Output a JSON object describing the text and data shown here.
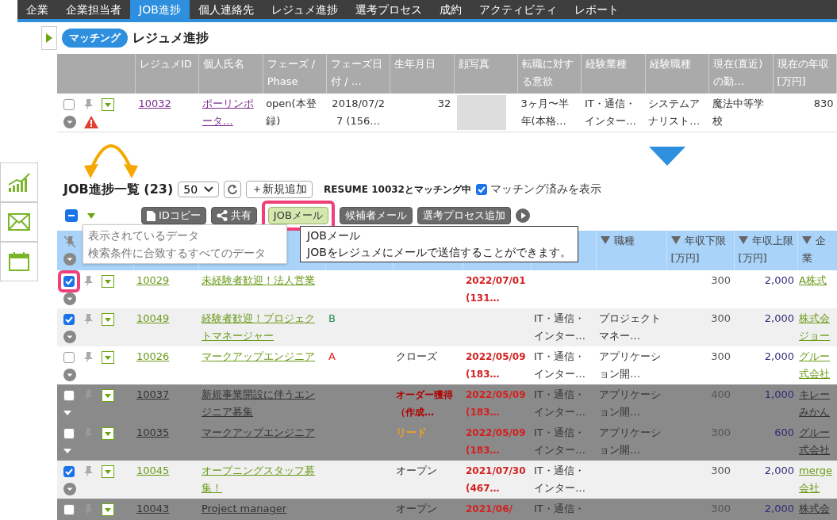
{
  "nav": {
    "tabs": [
      {
        "label": "企業",
        "selected": false
      },
      {
        "label": "企業担当者",
        "selected": false
      },
      {
        "label": "JOB進捗",
        "selected": true
      },
      {
        "label": "個人連絡先",
        "selected": false
      },
      {
        "label": "レジュメ進捗",
        "selected": false
      },
      {
        "label": "選考プロセス",
        "selected": false
      },
      {
        "label": "成約",
        "selected": false
      },
      {
        "label": "アクティビティ",
        "selected": false
      },
      {
        "label": "レポート",
        "selected": false
      }
    ]
  },
  "matching": {
    "badge": "マッチング",
    "title": "レジュメ進捗",
    "columns": [
      "レジュメID",
      "個人氏名",
      "フェーズ / Phase",
      "フェーズ日付 / …",
      "生年月日",
      "顔写真",
      "転職に対する意欲",
      "経験業種",
      "経験職種",
      "現在(直近)の勤…",
      "現在の年収 [万円]"
    ],
    "rows": [
      {
        "checked": false,
        "warning": true,
        "id": "10032",
        "name": "ポーリンポータ…",
        "phase": "open(本登録)",
        "phase_date": "2018/07/27 (156…",
        "age": "32",
        "motivation": "3ヶ月〜半年(本格…",
        "industry": "IT・通信・インター…",
        "job": "システムアナリスト…",
        "school": "魔法中等学校",
        "salary": "830"
      }
    ]
  },
  "job_list": {
    "title": "JOB進捗一覧 (23)",
    "page_size": "50",
    "add_button": "＋新規追加",
    "match_note": "RESUME 10032とマッチング中",
    "show_matched": {
      "label": "マッチング済みを表示",
      "checked": true
    },
    "select_all": {
      "checked": true,
      "indeterminate": true
    },
    "toolbar": [
      {
        "label": "IDコピー",
        "active": false,
        "highlighted": false
      },
      {
        "label": "共有",
        "active": false,
        "highlighted": false
      },
      {
        "label": "JOBメール",
        "active": true,
        "highlighted": true
      },
      {
        "label": "候補者メール",
        "active": false,
        "highlighted": false
      },
      {
        "label": "選考プロセス追加",
        "active": false,
        "highlighted": false
      }
    ],
    "select_menu": [
      "表示されているデータ",
      "検索条件に合致するすべてのデータ"
    ],
    "tooltip": {
      "title": "JOBメール",
      "text": "JOBをレジュメにメールで送信することができます。"
    },
    "columns": [
      "職種",
      "年収下限 [万円]",
      "年収上限 [万円]",
      "企業"
    ],
    "rows": [
      {
        "checked": true,
        "highlighted": true,
        "dimmed": false,
        "id": "10029",
        "title": "未経験者歓迎！法人営業",
        "date": "2022/07/01 (131…",
        "salary_min": "300",
        "salary_max": "2,000",
        "company": "A株式"
      },
      {
        "checked": true,
        "highlighted": false,
        "dimmed": false,
        "id": "10049",
        "title": "経験者歓迎！プロジェクトマネージャー",
        "rank": {
          "label": "B",
          "color": "#1e8a4c"
        },
        "industry": "IT・通信・インター…",
        "job": "プロジェクトマネー…",
        "salary_min": "300",
        "salary_max": "2,000",
        "company": "株式会ジョー"
      },
      {
        "checked": false,
        "highlighted": false,
        "dimmed": false,
        "id": "10026",
        "title": "マークアップエンジニア",
        "rank": {
          "label": "A",
          "color": "#e02020"
        },
        "phase": {
          "label": "クローズ",
          "kind": "normal"
        },
        "date": "2022/05/09 (183…",
        "industry": "IT・通信・インター…",
        "job": "アプリケーション開…",
        "salary_min": "300",
        "salary_max": "2,000",
        "company": "グルー式会社"
      },
      {
        "checked": false,
        "highlighted": false,
        "dimmed": true,
        "id": "10037",
        "title": "新規事業開設に伴うエンジニア募集",
        "phase": {
          "label": "オーダー獲得（作成…",
          "kind": "order"
        },
        "date": "2022/05/09 (183…",
        "industry": "IT・通信・インター…",
        "job": "アプリケーション開…",
        "salary_min": "400",
        "salary_max": "1,000",
        "company": "キレーみかん"
      },
      {
        "checked": false,
        "highlighted": false,
        "dimmed": true,
        "id": "10035",
        "title": "マークアップエンジニア",
        "phase": {
          "label": "リード",
          "kind": "lead"
        },
        "date": "2022/05/09 (183…",
        "industry": "IT・通信・インター…",
        "job": "アプリケーション開…",
        "salary_min": "300",
        "salary_max": "600",
        "company": "グルー式会社"
      },
      {
        "checked": true,
        "highlighted": false,
        "dimmed": false,
        "id": "10045",
        "title": "オープニングスタッフ募集！",
        "phase": {
          "label": "オープン",
          "kind": "normal"
        },
        "date": "2021/07/30 (467…",
        "industry": "IT・通信・インター…",
        "salary_min": "300",
        "salary_max": "2,000",
        "company": "merge会社"
      },
      {
        "checked": false,
        "highlighted": false,
        "dimmed": true,
        "id": "10043",
        "title": "Project manager",
        "phase": {
          "label": "オープン",
          "kind": "normal"
        },
        "date": "2021/06/",
        "industry": "IT・通信・",
        "salary_min": "300",
        "salary_max": "2,000",
        "company": "株式会"
      }
    ]
  }
}
